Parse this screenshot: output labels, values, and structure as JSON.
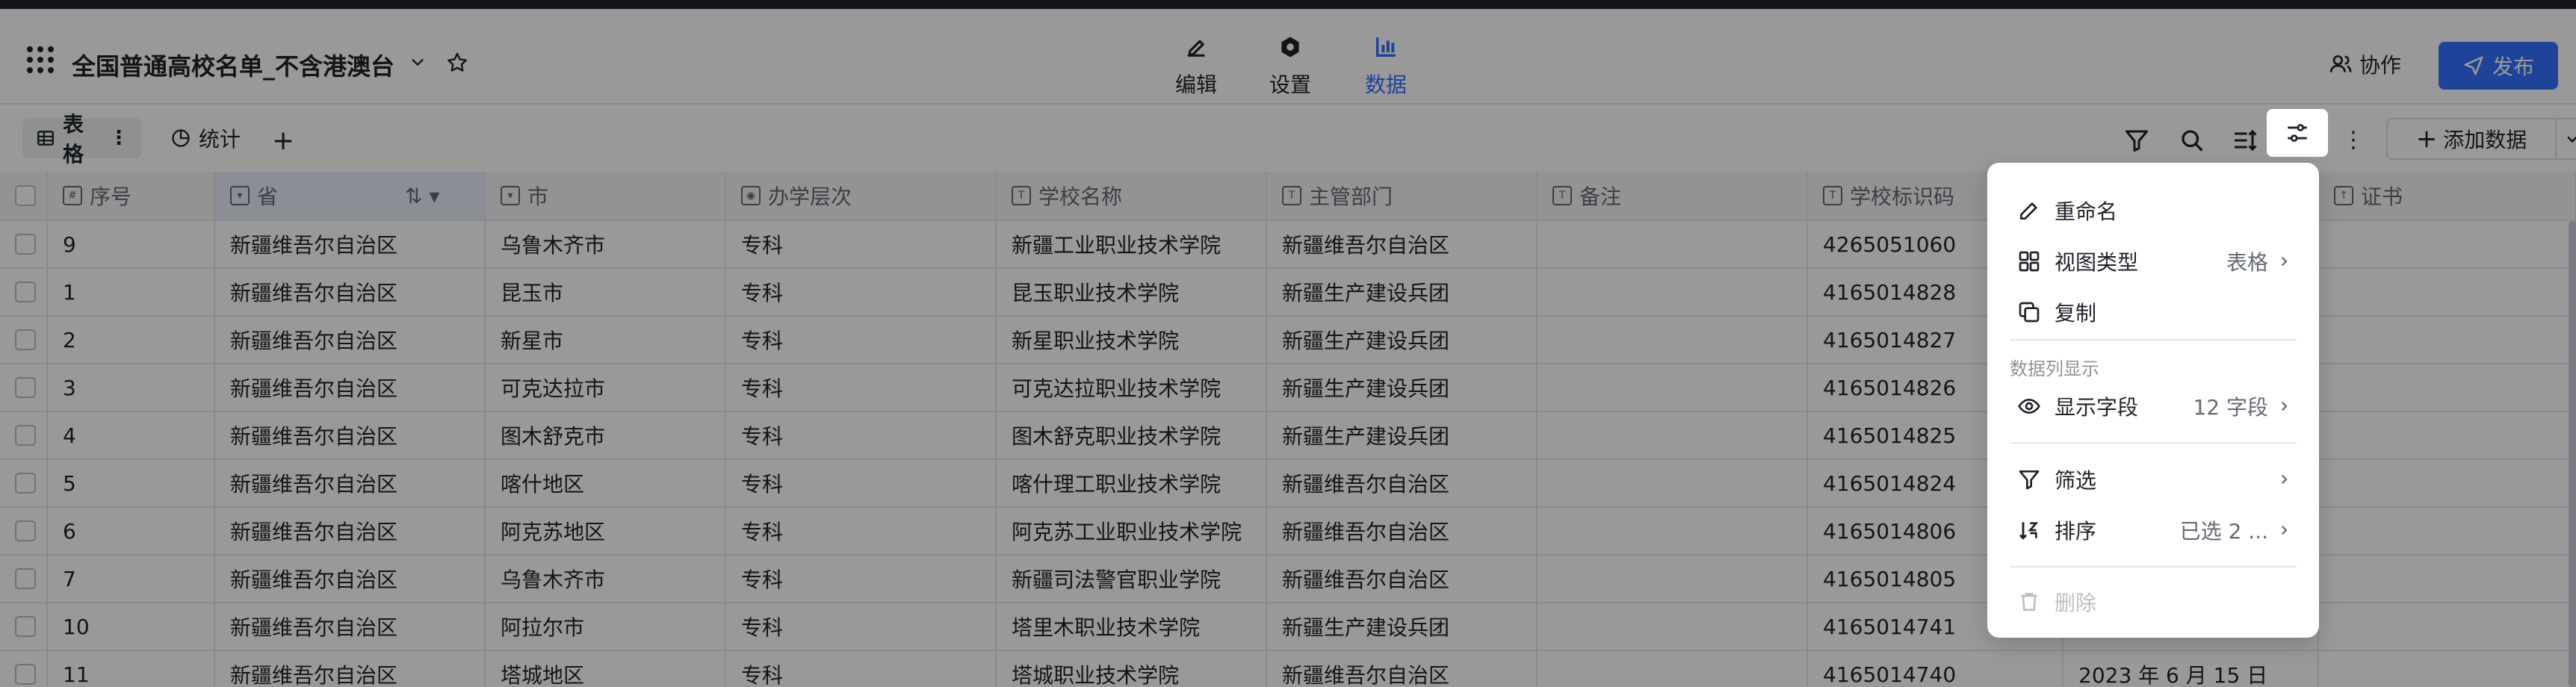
{
  "header": {
    "title": "全国普通高校名单_不含港澳台",
    "mode_tabs": [
      {
        "label": "编辑",
        "icon": "edit-icon"
      },
      {
        "label": "设置",
        "icon": "settings-icon"
      },
      {
        "label": "数据",
        "icon": "chart-icon"
      }
    ],
    "active_mode": "数据",
    "collab_label": "协作",
    "publish_label": "发布"
  },
  "toolbar": {
    "views": [
      {
        "label": "表格",
        "icon": "table-icon"
      },
      {
        "label": "统计",
        "icon": "pie-icon"
      }
    ],
    "add_view": "+",
    "add_data_label": "添加数据"
  },
  "grid": {
    "columns": [
      {
        "label": "序号",
        "type": "number"
      },
      {
        "label": "省",
        "type": "select"
      },
      {
        "label": "市",
        "type": "select"
      },
      {
        "label": "办学层次",
        "type": "radio"
      },
      {
        "label": "学校名称",
        "type": "text"
      },
      {
        "label": "主管部门",
        "type": "text"
      },
      {
        "label": "备注",
        "type": "text"
      },
      {
        "label": "学校标识码",
        "type": "text"
      },
      {
        "label": "",
        "type": "hidden"
      },
      {
        "label": "证书",
        "type": "upload"
      }
    ],
    "rows": [
      [
        "9",
        "新疆维吾尔自治区",
        "乌鲁木齐市",
        "专科",
        "新疆工业职业技术学院",
        "新疆维吾尔自治区",
        "",
        "4265051060",
        "",
        ""
      ],
      [
        "1",
        "新疆维吾尔自治区",
        "昆玉市",
        "专科",
        "昆玉职业技术学院",
        "新疆生产建设兵团",
        "",
        "4165014828",
        "",
        ""
      ],
      [
        "2",
        "新疆维吾尔自治区",
        "新星市",
        "专科",
        "新星职业技术学院",
        "新疆生产建设兵团",
        "",
        "4165014827",
        "",
        ""
      ],
      [
        "3",
        "新疆维吾尔自治区",
        "可克达拉市",
        "专科",
        "可克达拉职业技术学院",
        "新疆生产建设兵团",
        "",
        "4165014826",
        "",
        ""
      ],
      [
        "4",
        "新疆维吾尔自治区",
        "图木舒克市",
        "专科",
        "图木舒克职业技术学院",
        "新疆生产建设兵团",
        "",
        "4165014825",
        "",
        ""
      ],
      [
        "5",
        "新疆维吾尔自治区",
        "喀什地区",
        "专科",
        "喀什理工职业技术学院",
        "新疆维吾尔自治区",
        "",
        "4165014824",
        "",
        ""
      ],
      [
        "6",
        "新疆维吾尔自治区",
        "阿克苏地区",
        "专科",
        "阿克苏工业职业技术学院",
        "新疆维吾尔自治区",
        "",
        "4165014806",
        "",
        ""
      ],
      [
        "7",
        "新疆维吾尔自治区",
        "乌鲁木齐市",
        "专科",
        "新疆司法警官职业学院",
        "新疆维吾尔自治区",
        "",
        "4165014805",
        "",
        ""
      ],
      [
        "10",
        "新疆维吾尔自治区",
        "阿拉尔市",
        "专科",
        "塔里木职业技术学院",
        "新疆生产建设兵团",
        "",
        "4165014741",
        "",
        ""
      ],
      [
        "11",
        "新疆维吾尔自治区",
        "塔城地区",
        "专科",
        "塔城职业技术学院",
        "新疆维吾尔自治区",
        "",
        "4165014740",
        "2023 年 6 月 15 日",
        ""
      ]
    ]
  },
  "menu": {
    "rename": "重命名",
    "view_type": "视图类型",
    "view_type_value": "表格",
    "copy": "复制",
    "section_label": "数据列显示",
    "show_fields": "显示字段",
    "show_fields_value": "12 字段",
    "filter": "筛选",
    "sort": "排序",
    "sort_value": "已选 2 ...",
    "delete": "删除"
  },
  "colors": {
    "accent": "#3370ff",
    "overlay": "rgba(0,0,0,0.40)",
    "text": "#1f2329",
    "muted": "#646a73"
  }
}
